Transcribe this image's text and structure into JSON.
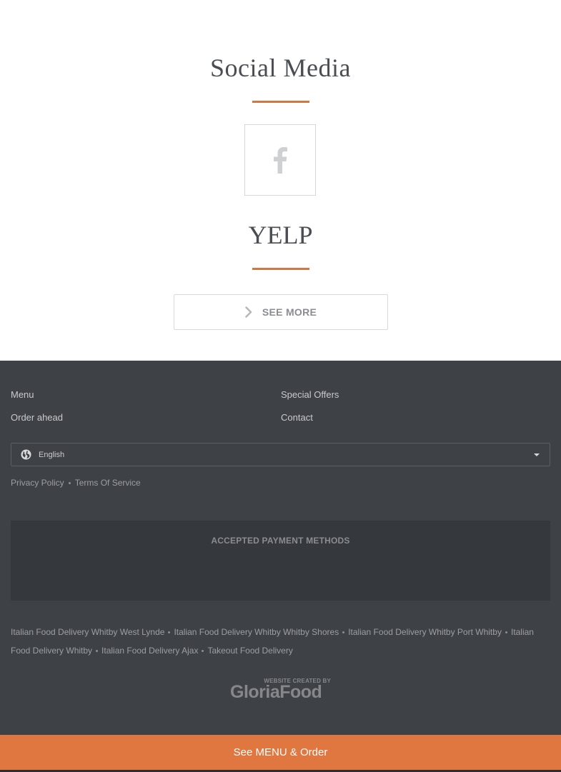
{
  "social": {
    "heading": "Social Media",
    "facebook_icon": "facebook-icon"
  },
  "yelp": {
    "heading": "YELP",
    "see_more_label": "SEE MORE",
    "see_more_icon": "chevron-right-icon"
  },
  "footer": {
    "nav": {
      "menu": "Menu",
      "order_ahead": "Order ahead",
      "special_offers": "Special Offers",
      "contact": "Contact"
    },
    "language": {
      "value": "English",
      "icon": "globe-icon"
    },
    "legal": {
      "privacy": "Privacy Policy",
      "terms": "Terms Of Service"
    },
    "payment": {
      "title": "ACCEPTED PAYMENT METHODS"
    },
    "links": [
      "Italian Food Delivery Whitby West Lynde",
      "Italian Food Delivery Whitby Whitby Shores",
      "Italian Food Delivery Whitby Port Whitby",
      "Italian Food Delivery Whitby",
      "Italian Food Delivery Ajax",
      "Takeout Food Delivery"
    ],
    "brand": {
      "small": "WEBSITE CREATED BY",
      "name": "GloriaFood"
    }
  },
  "cta": {
    "label": "See MENU & Order"
  },
  "colors": {
    "accent": "#e07640",
    "footer_bg": "#3e4146",
    "heading": "#4a4d52"
  }
}
